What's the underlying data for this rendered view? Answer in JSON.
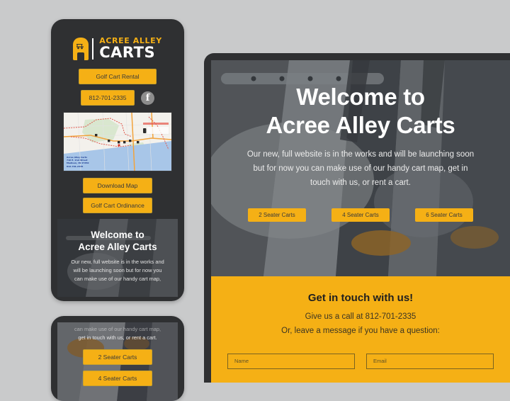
{
  "page": {
    "background_color": "#c9cacb",
    "accent_color": "#f5b015",
    "dark_color": "#2f3032"
  },
  "brand": {
    "line1": "ACREE ALLEY",
    "line2": "CARTS",
    "logo_icon": "golf-cart-in-arch-icon"
  },
  "mobile": {
    "nav": {
      "rental_button": "Golf Cart Rental",
      "phone_button": "812-701-2335",
      "facebook_icon": "facebook-icon",
      "facebook_glyph": "f"
    },
    "map": {
      "icon": "map-image",
      "address_line1": "Acree Alley Carts",
      "address_line2": "716 E. 2nd Street",
      "address_line3": "Madison, IN 47250",
      "address_line4": "812-701-2335"
    },
    "map_buttons": [
      "Download Map",
      "Golf Cart Ordinance"
    ],
    "hero": {
      "title_line1": "Welcome to",
      "title_line2": "Acree Alley Carts",
      "paragraph_line1": "Our new, full website is in the works and",
      "paragraph_line2": "will be launching soon but for now you",
      "paragraph_line3": "can make use of our handy cart map,"
    }
  },
  "mobile_second": {
    "paragraph_cut": "can make use of our handy cart map,",
    "paragraph_line": "get in touch with us, or rent a cart.",
    "buttons": [
      "2 Seater Carts",
      "4 Seater Carts"
    ]
  },
  "desktop": {
    "hero": {
      "title_line1": "Welcome to",
      "title_line2": "Acree Alley Carts",
      "paragraph": "Our new, full website is in the works and will be launching soon but for now you can make use of our handy cart map, get in touch with us, or rent a cart."
    },
    "cart_buttons": [
      "2 Seater Carts",
      "4 Seater Carts",
      "6 Seater Carts"
    ],
    "contact": {
      "heading": "Get in touch with us!",
      "call_line": "Give us a call at 812-701-2335",
      "message_line": "Or, leave a message if you have a question:",
      "name_placeholder": "Name",
      "email_placeholder": "Email",
      "name_value": "",
      "email_value": ""
    }
  }
}
